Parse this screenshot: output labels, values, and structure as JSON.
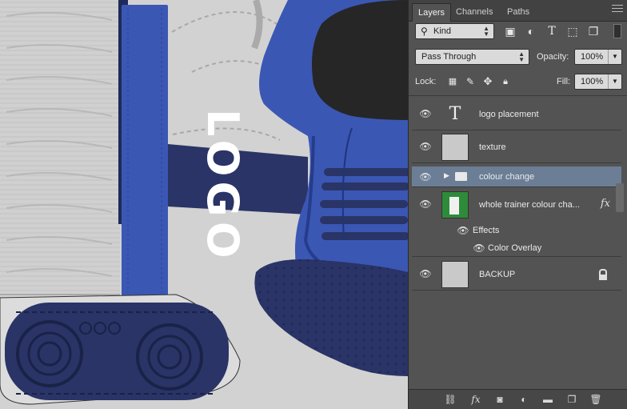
{
  "canvas": {
    "logo_text": "LOGO"
  },
  "panel": {
    "tabs": [
      {
        "label": "Layers",
        "active": true
      },
      {
        "label": "Channels",
        "active": false
      },
      {
        "label": "Paths",
        "active": false
      }
    ],
    "filter": {
      "kind_label": "Kind",
      "icons": [
        "image-filter-icon",
        "adjustment-filter-icon",
        "type-filter-icon",
        "shape-filter-icon",
        "smart-object-filter-icon"
      ]
    },
    "blend_mode": "Pass Through",
    "opacity_label": "Opacity:",
    "opacity_value": "100%",
    "lock_label": "Lock:",
    "fill_label": "Fill:",
    "fill_value": "100%",
    "layers": [
      {
        "name": "logo placement",
        "type": "text"
      },
      {
        "name": "texture",
        "type": "pixel"
      },
      {
        "name": "colour change",
        "type": "group",
        "selected": true
      },
      {
        "name": "whole trainer colour cha...",
        "type": "pixel",
        "fx": "fx"
      },
      {
        "effects_label": "Effects"
      },
      {
        "effect_name": "Color Overlay"
      },
      {
        "name": "BACKUP",
        "type": "pixel",
        "locked": true
      }
    ],
    "bottom_icons": [
      "link-layers-icon",
      "fx-icon",
      "add-mask-icon",
      "adjustment-layer-icon",
      "new-group-icon",
      "new-layer-icon",
      "delete-layer-icon"
    ],
    "colors": {
      "panel_bg": "#535353",
      "selected_row": "#6b7e96",
      "canvas_blue": "#3b57b4",
      "canvas_navy": "#2a3466"
    }
  }
}
